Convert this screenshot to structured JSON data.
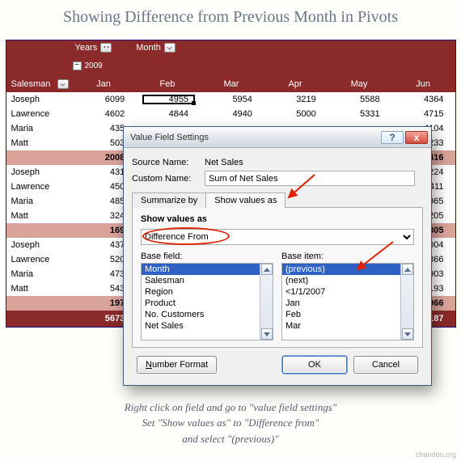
{
  "title": "Showing Difference from Previous Month in Pivots",
  "credit": "chandoo.org",
  "caption_lines": [
    "Right click on field and go to \"value field settings\"",
    "Set \"Show values as\" to \"Difference from\"",
    "and select \"(previous)\""
  ],
  "pivot": {
    "field_years": "Years",
    "field_month": "Month",
    "year_expand_symbol": "−",
    "year_value": "2009",
    "salesman_header": "Salesman",
    "months": [
      "Jan",
      "Feb",
      "Mar",
      "Apr",
      "May",
      "Jun"
    ],
    "groups": [
      {
        "rows": [
          {
            "name": "Joseph",
            "vals": [
              "6099",
              "4955",
              "5954",
              "3219",
              "5588",
              "4364"
            ]
          },
          {
            "name": "Lawrence",
            "vals": [
              "4602",
              "4844",
              "4940",
              "5000",
              "5331",
              "4715"
            ]
          },
          {
            "name": "Maria",
            "vals": [
              "435",
              "",
              "",
              "",
              "",
              "4104"
            ]
          },
          {
            "name": "Matt",
            "vals": [
              "503",
              "",
              "",
              "",
              "",
              "5233"
            ]
          }
        ],
        "subtotal": {
          "label": "2008",
          "last": "18416"
        }
      },
      {
        "rows": [
          {
            "name": "Joseph",
            "vals": [
              "431",
              "",
              "",
              "",
              "",
              "4224"
            ]
          },
          {
            "name": "Lawrence",
            "vals": [
              "450",
              "",
              "",
              "",
              "",
              "4411"
            ]
          },
          {
            "name": "Maria",
            "vals": [
              "485",
              "",
              "",
              "",
              "",
              "4965"
            ]
          },
          {
            "name": "Matt",
            "vals": [
              "324",
              "",
              "",
              "",
              "",
              "5205"
            ]
          }
        ],
        "subtotal": {
          "label": "169",
          "last": "18805"
        }
      },
      {
        "rows": [
          {
            "name": "Joseph",
            "vals": [
              "437",
              "",
              "",
              "",
              "",
              "5004"
            ]
          },
          {
            "name": "Lawrence",
            "vals": [
              "520",
              "",
              "",
              "",
              "",
              "4866"
            ]
          },
          {
            "name": "Maria",
            "vals": [
              "473",
              "",
              "",
              "",
              "",
              "4903"
            ]
          },
          {
            "name": "Matt",
            "vals": [
              "543",
              "",
              "",
              "",
              "",
              "5193"
            ]
          }
        ],
        "subtotal": {
          "label": "197",
          "last": "19966"
        }
      }
    ],
    "grand": {
      "first": "5673",
      "last": "57187"
    }
  },
  "dialog": {
    "title": "Value Field Settings",
    "help_symbol": "?",
    "close_symbol": "x",
    "source_label": "Source Name:",
    "source_value": "Net Sales",
    "custom_label": "Custom Name:",
    "custom_value": "Sum of Net Sales",
    "tab_summarize": "Summarize by",
    "tab_showvalues": "Show values as",
    "showvalues_label": "Show values as",
    "combo_value": "Difference From",
    "basefield_label": "Base field:",
    "baseitem_label": "Base item:",
    "basefields": [
      "Month",
      "Salesman",
      "Region",
      "Product",
      "No. Customers",
      "Net Sales"
    ],
    "basefield_selected": "Month",
    "baseitems": [
      "(previous)",
      "(next)",
      "<1/1/2007",
      "Jan",
      "Feb",
      "Mar"
    ],
    "baseitem_selected": "(previous)",
    "btn_number_format": "Number Format",
    "btn_ok": "OK",
    "btn_cancel": "Cancel"
  }
}
